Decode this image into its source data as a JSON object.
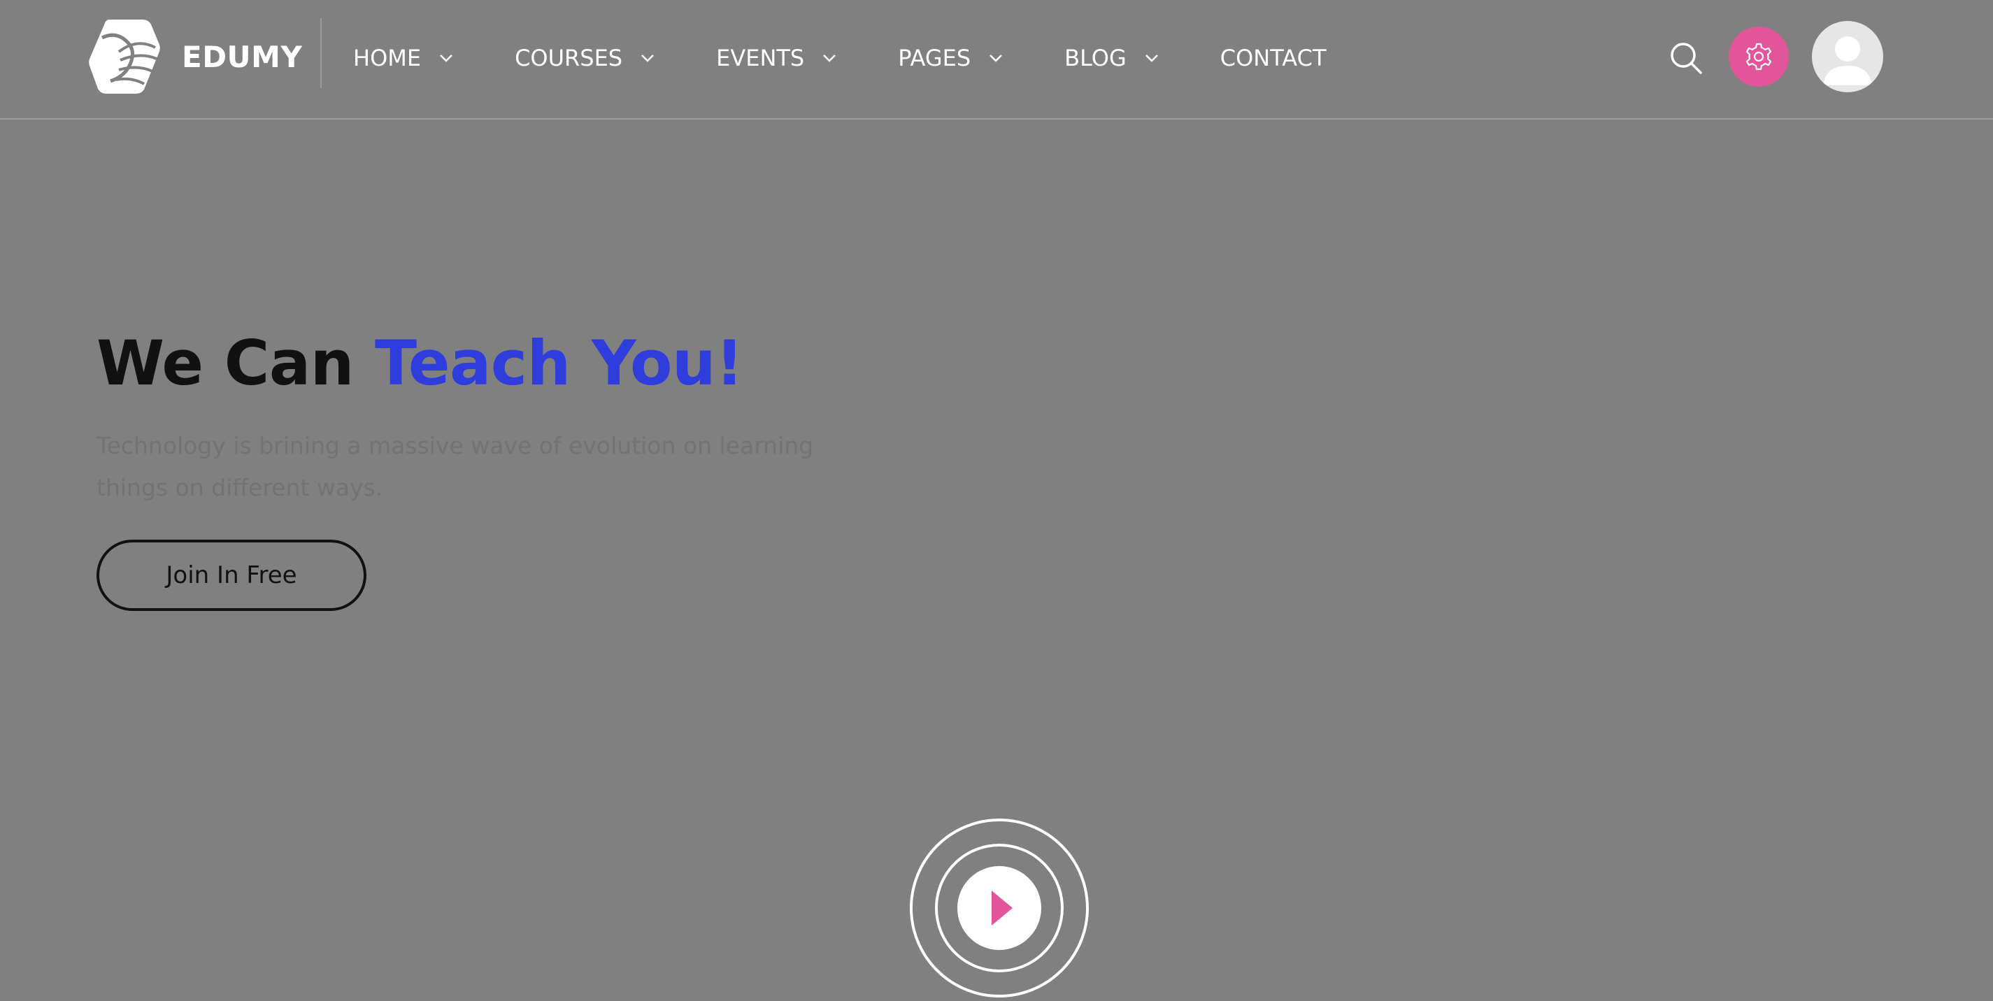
{
  "brand": {
    "name": "EDUMY",
    "logo_icon": "edumy-logo-icon"
  },
  "nav": {
    "items": [
      {
        "label": "HOME",
        "has_dropdown": true
      },
      {
        "label": "COURSES",
        "has_dropdown": true
      },
      {
        "label": "EVENTS",
        "has_dropdown": true
      },
      {
        "label": "PAGES",
        "has_dropdown": true
      },
      {
        "label": "BLOG",
        "has_dropdown": true
      },
      {
        "label": "CONTACT",
        "has_dropdown": false
      }
    ]
  },
  "header_actions": {
    "search_icon": "search-icon",
    "settings_icon": "gear-icon",
    "avatar_icon": "user-avatar-icon"
  },
  "hero": {
    "title_part1": "We Can ",
    "title_accent": "Teach You!",
    "description": "Technology is brining a massive wave of evolution on learning things on different ways.",
    "cta_label": "Join In Free"
  },
  "video": {
    "icon": "play-icon"
  },
  "colors": {
    "overlay_background": "#808080",
    "accent_blue": "#2e3ddb",
    "accent_pink": "#e2559a",
    "text_dark": "#111111",
    "text_muted": "#737373",
    "white": "#ffffff"
  }
}
